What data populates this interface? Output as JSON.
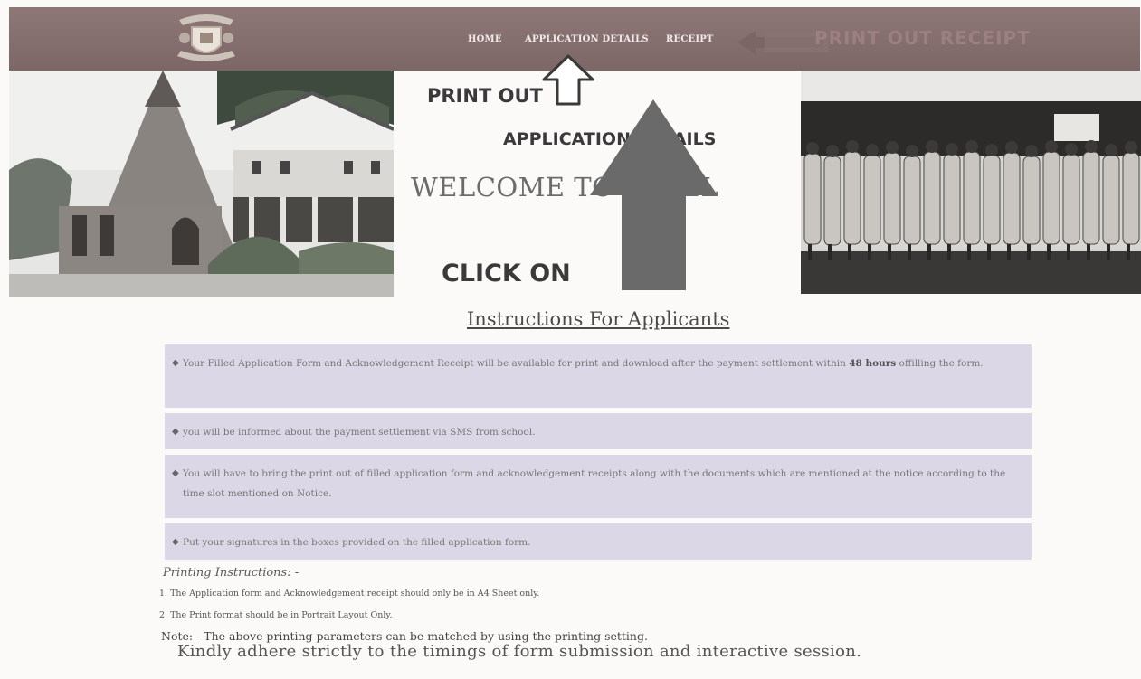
{
  "nav": {
    "home": "HOME",
    "application_details": "APPLICATION DETAILS",
    "receipt": "RECEIPT",
    "banner_text": "PRINT OUT RECEIPT"
  },
  "hero": {
    "welcome_text": "WELCOME TO PANEL",
    "annotation_print_out": "PRINT OUT",
    "annotation_application_details": "APPLICATION DETAILS",
    "annotation_click_on": "CLICK ON"
  },
  "instructions": {
    "title": "Instructions For Applicants",
    "items": [
      {
        "text_before": "Your Filled Application Form and Acknowledgement Receipt will be available for print and download after the payment settlement within ",
        "bold": "48 hours",
        "text_after": " offilling the form."
      },
      {
        "text": "you will be informed about the payment settlement via SMS from school."
      },
      {
        "text": "You will have to bring the print out of filled application form and acknowledgement receipts along with the documents which are mentioned at the notice according to the time slot mentioned on Notice."
      },
      {
        "text": "Put your signatures in the boxes provided on the filled application form."
      }
    ]
  },
  "printing": {
    "title": "Printing Instructions: -",
    "items": [
      "1. The Application form and Acknowledgement receipt should only be in A4 Sheet only.",
      "2. The Print format should be in Portrait Layout Only."
    ],
    "note": "Note: - The above printing parameters can be matched by using the printing setting.",
    "kindly": "Kindly adhere strictly to the timings of form submission and interactive session."
  },
  "colors": {
    "navbar": "#857070",
    "box_bg": "#dcd7e6",
    "arrow": "#6a6a6a"
  },
  "icons": {
    "logo": "school-crest-icon",
    "big_arrow": "arrow-up-icon",
    "small_arrow": "outline-arrow-up-icon",
    "bullet": "bullet-icon"
  }
}
